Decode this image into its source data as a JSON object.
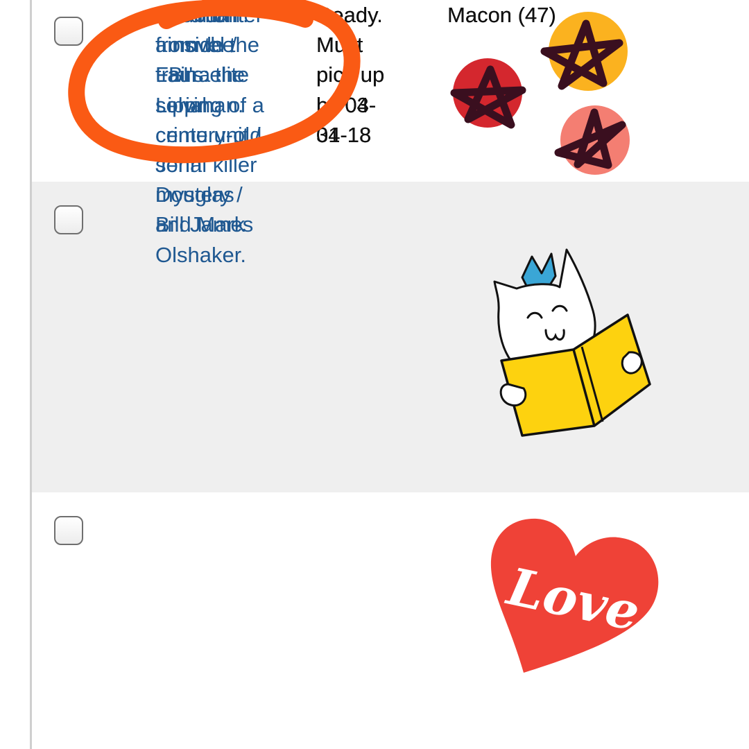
{
  "holds": [
    {
      "title_lines": [
        "Sunburn :",
        "a novel /",
        "Laura",
        "Lippman."
      ],
      "status_lines": [
        "Ready.",
        "Must",
        "pick up",
        "by 04-",
        "04-18"
      ],
      "location": "Macon (47)",
      "sticker": "doodle-stars-sticker"
    },
    {
      "title_lines": [
        "Mindhunter",
        ": inside the",
        "FBI's elite",
        "serial",
        "crime unit /",
        "John",
        "Douglas",
        "and Mark",
        "Olshaker."
      ],
      "status_lines": [
        "Ready.",
        "Must",
        "pick up",
        "by 03-",
        "31-18"
      ],
      "location": "Macon (47)",
      "sticker": "cat-reading-book-sticker"
    },
    {
      "title_lines": [
        "The man",
        "from the",
        "train : the",
        "solving of a",
        "century-old",
        "serial killer",
        "mystery /",
        "Bill James"
      ],
      "status_lines": [
        "Ready.",
        "Must",
        "pick up",
        "by 04-",
        "04-18"
      ],
      "location": "Macon (47)",
      "sticker": "love-heart-sticker",
      "sticker_text": "Love"
    }
  ],
  "colors": {
    "link": "#1f5891",
    "text": "#111111",
    "row_alt_bg": "#efefef",
    "circle_marker": "#fa5a14",
    "heart": "#ef4237",
    "book": "#fdd20f",
    "crown": "#3aa6d6"
  }
}
